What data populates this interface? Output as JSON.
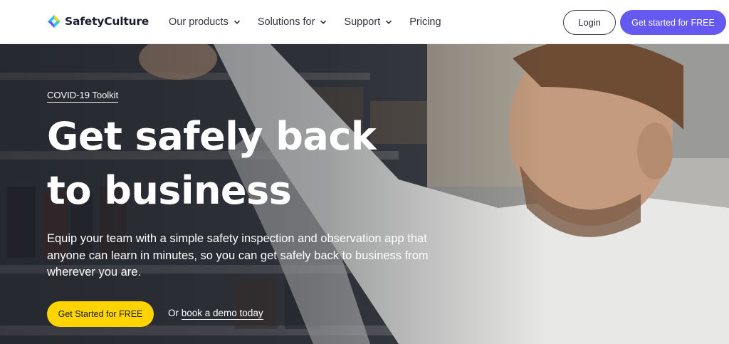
{
  "brand": {
    "name": "SafetyCulture"
  },
  "nav": {
    "items": [
      {
        "label": "Our products",
        "has_dropdown": true
      },
      {
        "label": "Solutions for",
        "has_dropdown": true
      },
      {
        "label": "Support",
        "has_dropdown": true
      },
      {
        "label": "Pricing",
        "has_dropdown": false
      }
    ]
  },
  "header_actions": {
    "login_label": "Login",
    "get_started_label": "Get started for FREE"
  },
  "hero": {
    "eyebrow": "COVID-19 Toolkit",
    "headline_line1": "Get safely back",
    "headline_line2": "to business",
    "subtext": "Equip your team with a simple safety inspection and observation app that anyone can learn in minutes, so you can get safely back to business from wherever you are.",
    "cta_label": "Get Started for FREE",
    "demo_prefix": "Or ",
    "demo_link": "book a demo today"
  },
  "colors": {
    "primary": "#6559f2",
    "cta_yellow": "#ffd400",
    "text_dark": "#1b1c2e"
  },
  "icons": {
    "logo": "safetyculture-logo-icon",
    "dropdown": "chevron-down-icon"
  }
}
